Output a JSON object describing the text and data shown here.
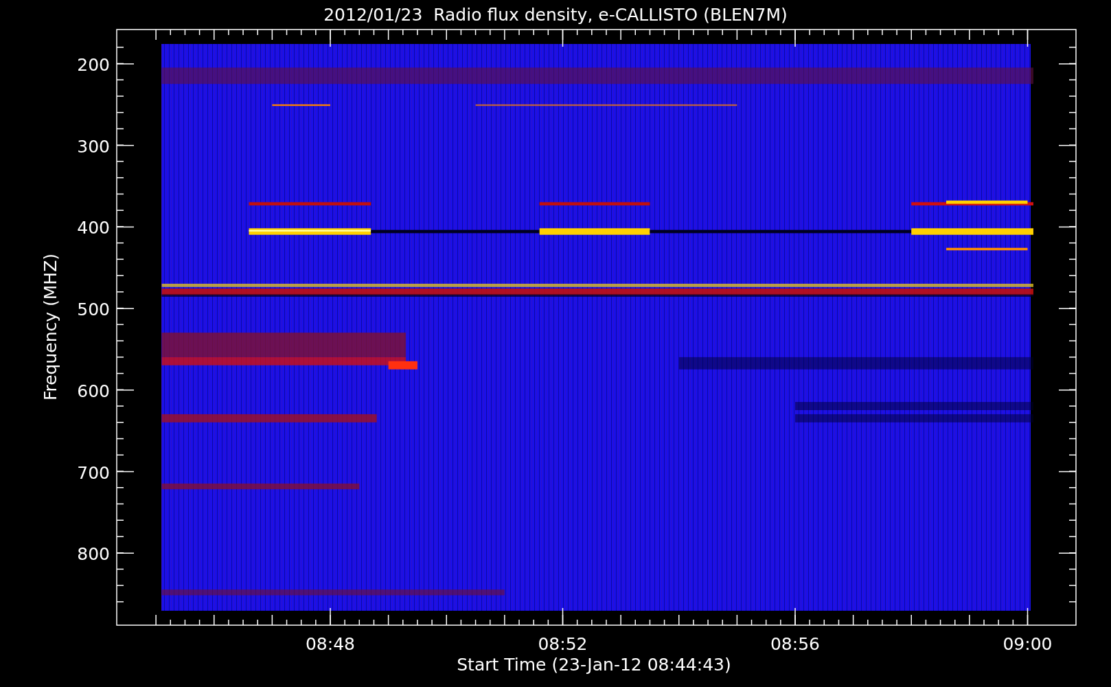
{
  "title": "2012/01/23  Radio flux density, e-CALLISTO (BLEN7M)",
  "y_axis": {
    "label": "Frequency (MHZ)",
    "ticks": [
      "200",
      "300",
      "400",
      "500",
      "600",
      "700",
      "800"
    ]
  },
  "x_axis": {
    "label": "Start Time (23-Jan-12 08:44:43)",
    "ticks": [
      "08:48",
      "08:52",
      "08:56",
      "09:00"
    ]
  }
}
